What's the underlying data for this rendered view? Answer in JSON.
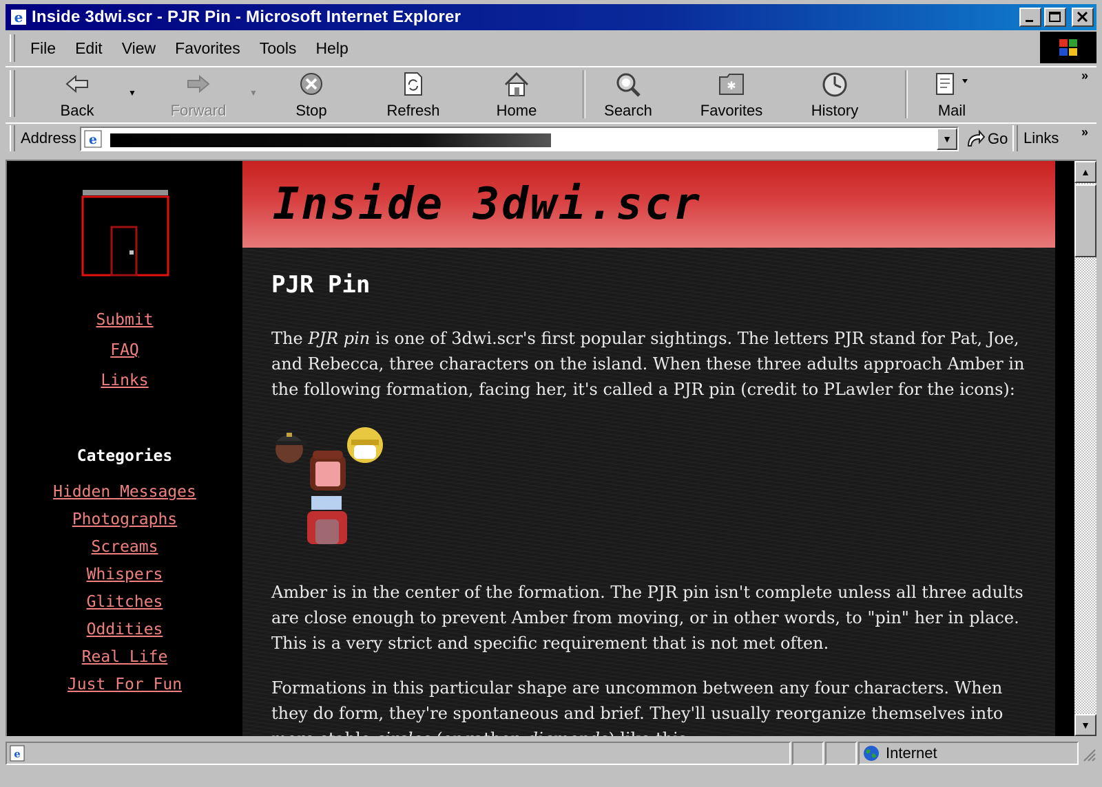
{
  "window": {
    "title": "Inside 3dwi.scr - PJR Pin - Microsoft Internet Explorer"
  },
  "menu": [
    "File",
    "Edit",
    "View",
    "Favorites",
    "Tools",
    "Help"
  ],
  "toolbar": {
    "back": "Back",
    "forward": "Forward",
    "stop": "Stop",
    "refresh": "Refresh",
    "home": "Home",
    "search": "Search",
    "favorites": "Favorites",
    "history": "History",
    "mail": "Mail"
  },
  "address": {
    "label": "Address",
    "go": "Go",
    "links": "Links"
  },
  "sidebar": {
    "top_links": [
      "Submit",
      "FAQ",
      "Links"
    ],
    "categories_title": "Categories",
    "categories": [
      "Hidden Messages",
      "Photographs",
      "Screams",
      "Whispers",
      "Glitches",
      "Oddities",
      "Real Life",
      "Just For Fun"
    ]
  },
  "page": {
    "banner_title": "Inside 3dwi.scr",
    "heading": "PJR Pin",
    "p1_a": "The ",
    "p1_em": "PJR pin",
    "p1_b": " is one of 3dwi.scr's first popular sightings. The letters PJR stand for Pat, Joe, and Rebecca, three characters on the island. When these three adults approach Amber in the following formation, facing her, it's called a PJR pin (credit to PLawler for the icons):",
    "p2": "Amber is in the center of the formation. The PJR pin isn't complete unless all three adults are close enough to prevent Amber from moving, or in other words, to \"pin\" her in place. This is a very strict and specific requirement that is not met often.",
    "p3_a": "Formations in this particular shape are uncommon between any four characters. When they do form, they're spontaneous and brief. They'll usually reorganize themselves into more stable ",
    "p3_em1": "circles",
    "p3_b": " (or rather, ",
    "p3_em2": "diamonds",
    "p3_c": ") like this:"
  },
  "status": {
    "zone": "Internet"
  },
  "colors": {
    "link": "#f08080",
    "banner_top": "#c82020",
    "banner_bottom": "#e87a7a",
    "titlebar": "#000080"
  }
}
